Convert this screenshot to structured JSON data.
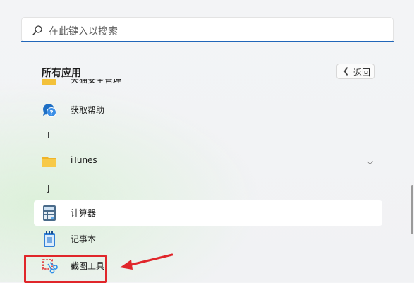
{
  "search": {
    "placeholder": "在此键入以搜索"
  },
  "header": {
    "title": "所有应用",
    "back_label": "返回"
  },
  "list": {
    "partial_item": "天猫安全管理",
    "items": [
      {
        "label": "获取帮助",
        "icon": "help-icon"
      },
      {
        "label": "iTunes",
        "icon": "folder-icon"
      },
      {
        "label": "计算器",
        "icon": "calculator-icon"
      },
      {
        "label": "记事本",
        "icon": "notepad-icon"
      },
      {
        "label": "截图工具",
        "icon": "snipping-tool-icon"
      }
    ],
    "letters": [
      "I",
      "J"
    ]
  },
  "colors": {
    "accent": "#2166b9",
    "annotation": "#e0262a"
  }
}
